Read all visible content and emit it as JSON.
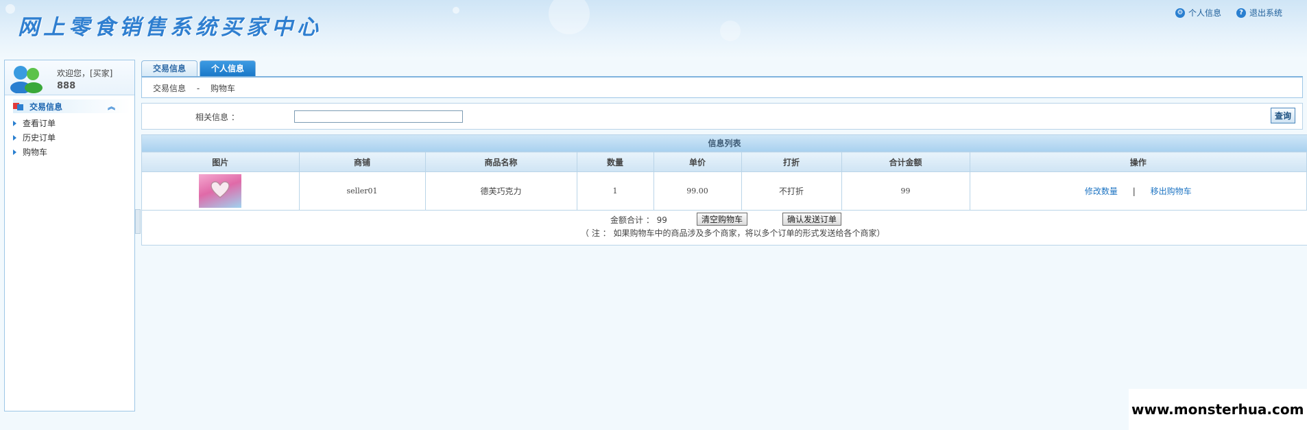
{
  "header": {
    "title": "网上零食销售系统买家中心",
    "links": [
      {
        "label": "个人信息",
        "icon": "settings-icon"
      },
      {
        "label": "退出系统",
        "icon": "help-icon"
      }
    ]
  },
  "sidebar": {
    "welcome": "欢迎您，[买家]",
    "username": "888",
    "section_title": "交易信息",
    "items": [
      {
        "label": "查看订单"
      },
      {
        "label": "历史订单"
      },
      {
        "label": "购物车"
      }
    ]
  },
  "tabs": [
    {
      "label": "交易信息",
      "active": false
    },
    {
      "label": "个人信息",
      "active": true
    }
  ],
  "breadcrumb": {
    "section": "交易信息",
    "separator": "-",
    "page": "购物车"
  },
  "search": {
    "label": "相关信息 ：",
    "value": "",
    "button": "查询"
  },
  "list": {
    "title": "信息列表",
    "columns": [
      "图片",
      "商铺",
      "商品名称",
      "数量",
      "单价",
      "打折",
      "合计金额",
      "操作"
    ],
    "rows": [
      {
        "shop": "seller01",
        "product": "德芙巧克力",
        "qty": "1",
        "price": "99.00",
        "discount": "不打折",
        "total": "99",
        "actions": {
          "edit": "修改数量",
          "sep": "|",
          "remove": "移出购物车"
        }
      }
    ],
    "total_label": "金额合计 ： 99",
    "clear_button": "清空购物车",
    "confirm_button": "确认发送订单",
    "note": "（ 注 ： 如果购物车中的商品涉及多个商家，将以多个订单的形式发送给各个商家）"
  },
  "watermark": "www.monsterhua.com",
  "colors": {
    "accent": "#2a7fd0",
    "border": "#9dc6e6",
    "link": "#1f75c3"
  }
}
